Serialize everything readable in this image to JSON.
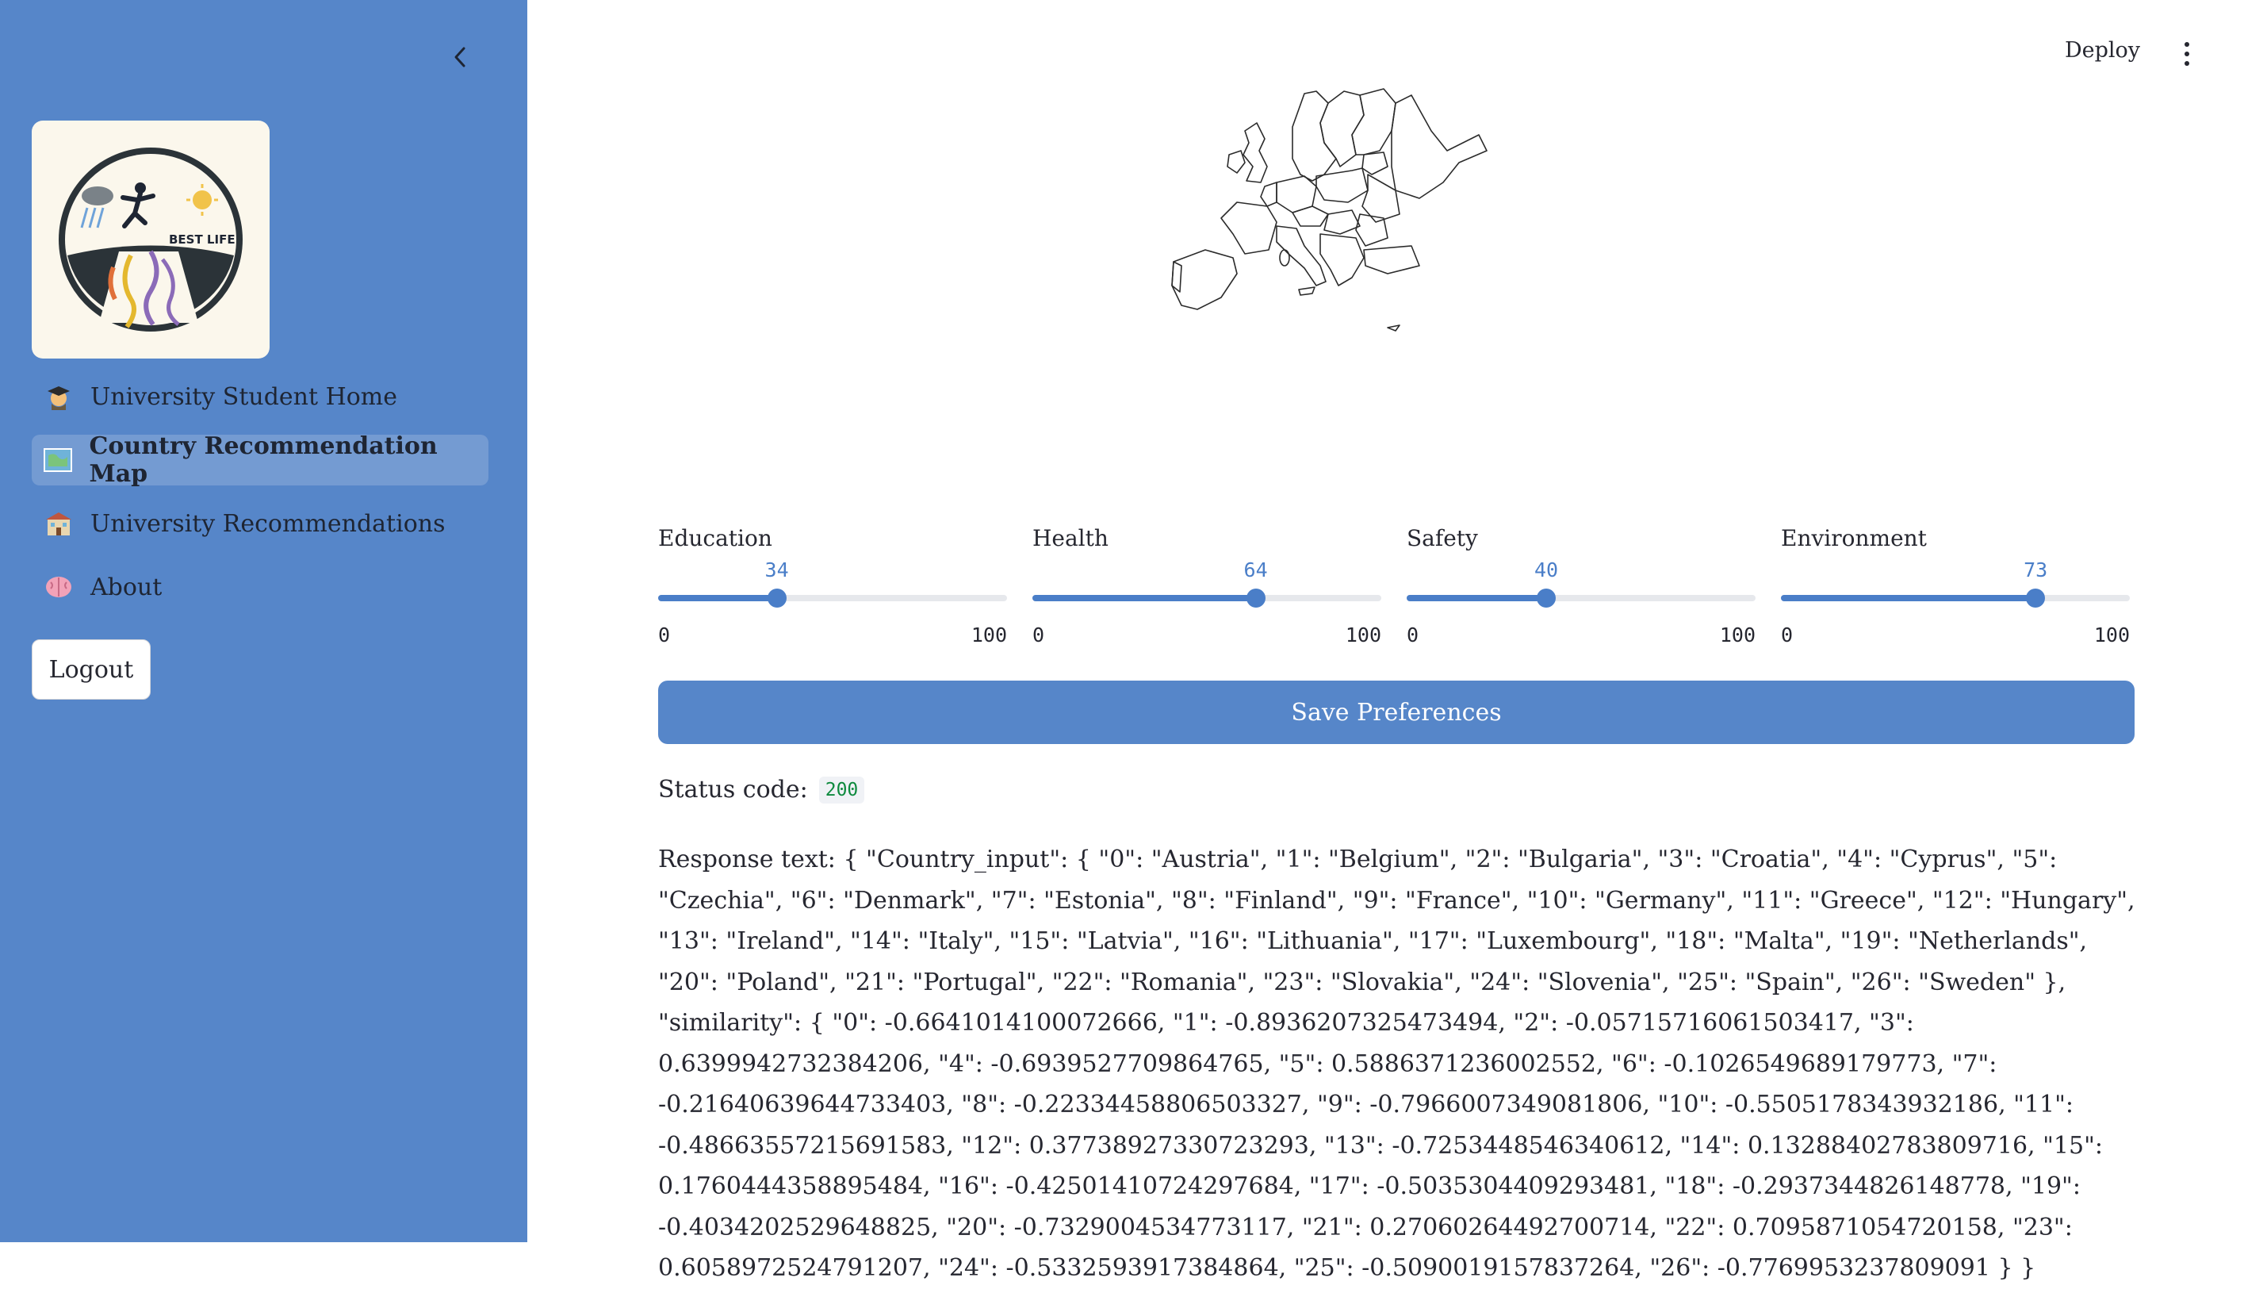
{
  "sidebar": {
    "logo_text": "BEST LIFE",
    "items": [
      {
        "label": "University Student Home",
        "icon": "graduate-emoji",
        "active": false
      },
      {
        "label": "Country Recommendation Map",
        "icon": "map-emoji",
        "active": true
      },
      {
        "label": "University Recommendations",
        "icon": "school-emoji",
        "active": false
      },
      {
        "label": "About",
        "icon": "brain-emoji",
        "active": false
      }
    ],
    "logout_label": "Logout"
  },
  "header": {
    "deploy_label": "Deploy",
    "menu_icon": "kebab-menu-icon"
  },
  "sliders": [
    {
      "label": "Education",
      "value": "34",
      "min": "0",
      "max": "100"
    },
    {
      "label": "Health",
      "value": "64",
      "min": "0",
      "max": "100"
    },
    {
      "label": "Safety",
      "value": "40",
      "min": "0",
      "max": "100"
    },
    {
      "label": "Environment",
      "value": "73",
      "min": "0",
      "max": "100"
    }
  ],
  "save_label": "Save Preferences",
  "status": {
    "label": "Status code:",
    "code": "200"
  },
  "response_text": "Response text: { \"Country_input\": { \"0\": \"Austria\", \"1\": \"Belgium\", \"2\": \"Bulgaria\", \"3\": \"Croatia\", \"4\": \"Cyprus\", \"5\": \"Czechia\", \"6\": \"Denmark\", \"7\": \"Estonia\", \"8\": \"Finland\", \"9\": \"France\", \"10\": \"Germany\", \"11\": \"Greece\", \"12\": \"Hungary\", \"13\": \"Ireland\", \"14\": \"Italy\", \"15\": \"Latvia\", \"16\": \"Lithuania\", \"17\": \"Luxembourg\", \"18\": \"Malta\", \"19\": \"Netherlands\", \"20\": \"Poland\", \"21\": \"Portugal\", \"22\": \"Romania\", \"23\": \"Slovakia\", \"24\": \"Slovenia\", \"25\": \"Spain\", \"26\": \"Sweden\" }, \"similarity\": { \"0\": -0.6641014100072666, \"1\": -0.8936207325473494, \"2\": -0.05715716061503417, \"3\": 0.6399942732384206, \"4\": -0.6939527709864765, \"5\": 0.5886371236002552, \"6\": -0.1026549689179773, \"7\": -0.21640639644733403, \"8\": -0.22334458806503327, \"9\": -0.7966007349081806, \"10\": -0.5505178343932186, \"11\": -0.48663557215691583, \"12\": 0.37738927330723293, \"13\": -0.7253448546340612, \"14\": 0.13288402783809716, \"15\": 0.1760444358895484, \"16\": -0.42501410724297684, \"17\": -0.5035304409293481, \"18\": -0.2937344826148778, \"19\": -0.4034202529648825, \"20\": -0.7329004534773117, \"21\": 0.27060264492700714, \"22\": 0.7095871054720158, \"23\": 0.6058972524791207, \"24\": -0.5332593917384864, \"25\": -0.5090019157837264, \"26\": -0.7769953237809091 } }",
  "colors": {
    "sidebar_bg": "#5686c9",
    "accent": "#4a7ec8",
    "status_green": "#0e8a3e"
  }
}
